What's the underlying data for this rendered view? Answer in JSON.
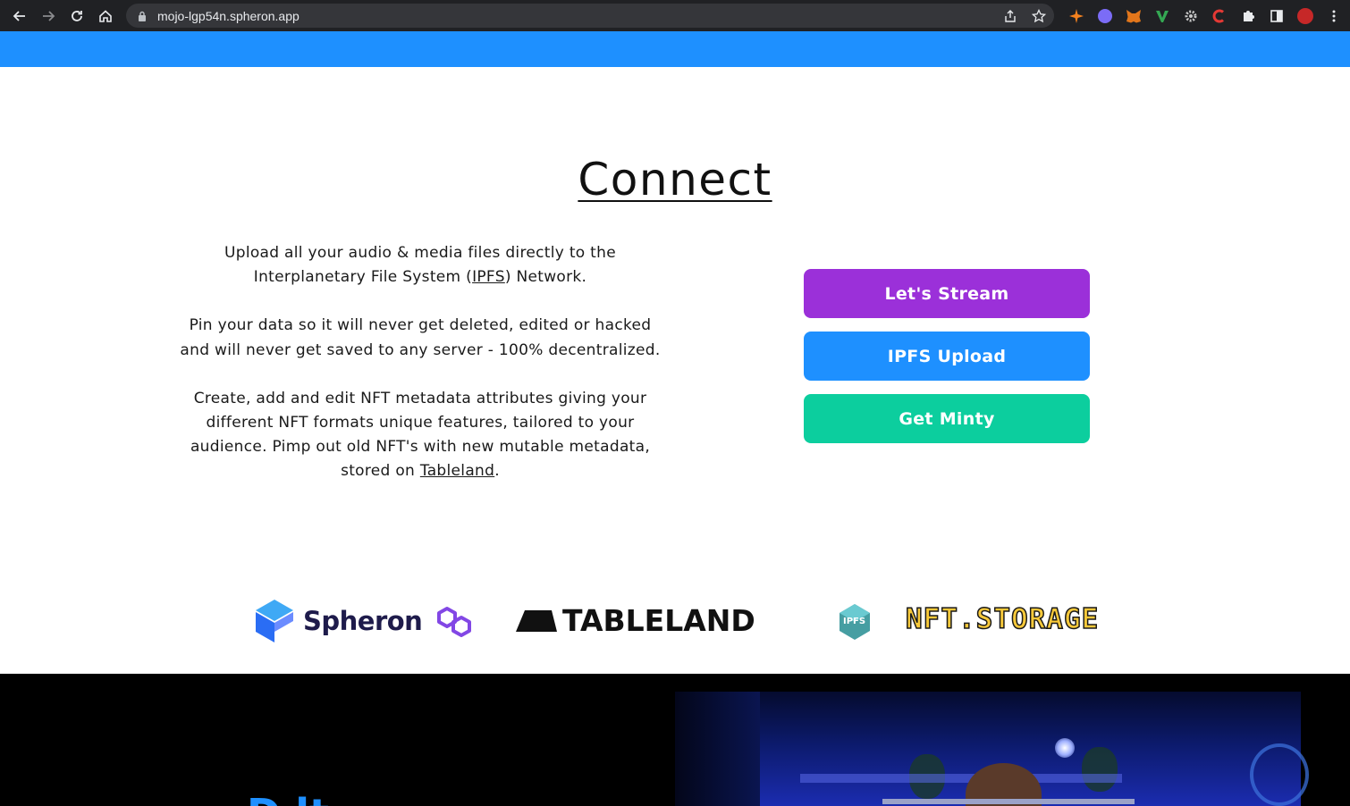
{
  "browser": {
    "url": "mojo-lgp54n.spheron.app"
  },
  "connect": {
    "title": "Connect",
    "para1_before": "Upload all your audio & media files directly to the Interplanetary File System (",
    "para1_link": "IPFS",
    "para1_after": ") Network.",
    "para2": "Pin your data so it will never get deleted, edited or hacked and will never get saved to any server - 100% decentralized.",
    "para3_before": "Create, add and edit NFT metadata attributes giving your different NFT formats unique features, tailored to your audience. Pimp out old NFT's with new mutable metadata, stored on ",
    "para3_link": "Tableland",
    "para3_after": "."
  },
  "actions": {
    "stream": {
      "label": "Let's Stream",
      "color": "#9b30d9"
    },
    "upload": {
      "label": "IPFS Upload",
      "color": "#1e90ff"
    },
    "minty": {
      "label": "Get Minty",
      "color": "#0cce9e"
    }
  },
  "logos": {
    "spheron": "Spheron",
    "tableland": "TABLELAND",
    "ipfs": "IPFS",
    "nftstorage": "NFT.STORAGE"
  },
  "colors": {
    "top_band": "#1e90ff",
    "spheron_mark": "#2a6df4",
    "polygon_mark": "#8247e5",
    "ipfs_mark": "#469ea2"
  },
  "hero": {
    "heading_partial": "D    lt"
  }
}
